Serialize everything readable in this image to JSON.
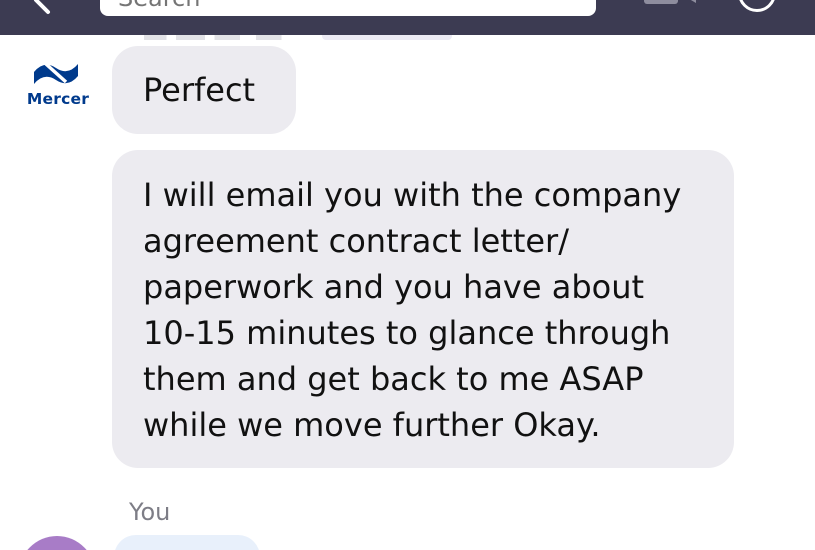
{
  "header": {
    "search_placeholder": "Search",
    "back_icon": "chevron-left-icon",
    "video_icon": "video-camera-icon",
    "profile_icon": "profile-circle-icon",
    "background_color": "#3c3b52"
  },
  "thread": {
    "sender_avatar": {
      "label": "Mercer",
      "brand_color": "#003a8c",
      "icon": "mercer-logo-icon"
    },
    "messages": [
      {
        "text": "Perfect"
      },
      {
        "text": "I will email you with the company\nagreement contract letter/\npaperwork and you have about\n10-15 minutes to glance through\nthem and get back to me ASAP\nwhile we move further Okay."
      }
    ],
    "you_label": "You",
    "bubble_color": "#ecebf0",
    "outgoing_bubble_color": "#e8f0fb",
    "my_avatar_color": "#a87cc7"
  }
}
